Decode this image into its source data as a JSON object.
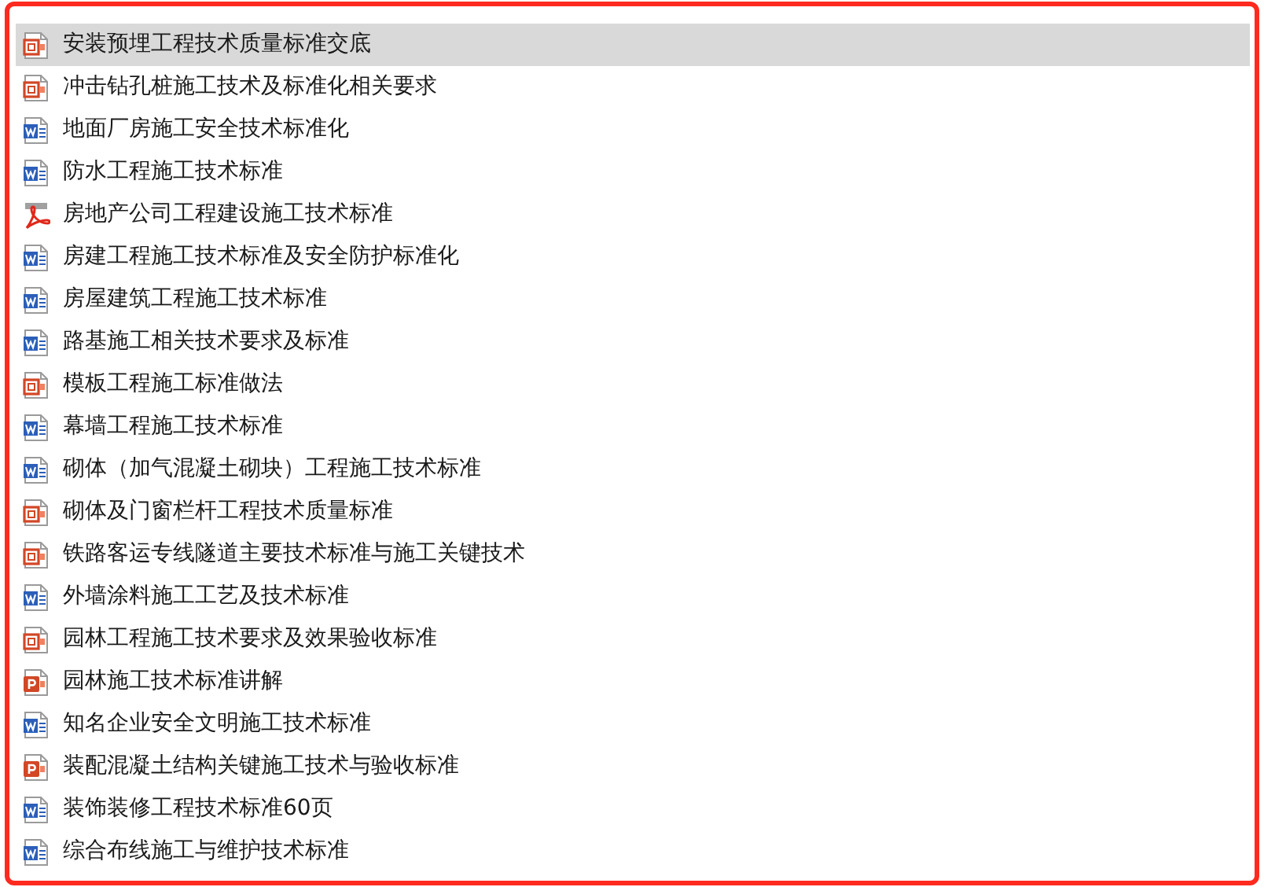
{
  "files": [
    {
      "name": "安装预埋工程技术质量标准交底",
      "kind": "slides-outline",
      "selected": true
    },
    {
      "name": "冲击钻孔桩施工技术及标准化相关要求",
      "kind": "slides-outline",
      "selected": false
    },
    {
      "name": "地面厂房施工安全技术标准化",
      "kind": "word",
      "selected": false
    },
    {
      "name": "防水工程施工技术标准",
      "kind": "word",
      "selected": false
    },
    {
      "name": "房地产公司工程建设施工技术标准",
      "kind": "pdf",
      "selected": false
    },
    {
      "name": "房建工程施工技术标准及安全防护标准化",
      "kind": "word",
      "selected": false
    },
    {
      "name": "房屋建筑工程施工技术标准",
      "kind": "word",
      "selected": false
    },
    {
      "name": "路基施工相关技术要求及标准",
      "kind": "word",
      "selected": false
    },
    {
      "name": "模板工程施工标准做法",
      "kind": "slides-outline",
      "selected": false
    },
    {
      "name": "幕墙工程施工技术标准",
      "kind": "word",
      "selected": false
    },
    {
      "name": "砌体（加气混凝土砌块）工程施工技术标准",
      "kind": "word",
      "selected": false
    },
    {
      "name": "砌体及门窗栏杆工程技术质量标准",
      "kind": "slides-outline",
      "selected": false
    },
    {
      "name": "铁路客运专线隧道主要技术标准与施工关键技术",
      "kind": "slides-outline",
      "selected": false
    },
    {
      "name": "外墙涂料施工工艺及技术标准",
      "kind": "word",
      "selected": false
    },
    {
      "name": "园林工程施工技术要求及效果验收标准",
      "kind": "slides-outline",
      "selected": false
    },
    {
      "name": "园林施工技术标准讲解",
      "kind": "slides",
      "selected": false
    },
    {
      "name": "知名企业安全文明施工技术标准",
      "kind": "word",
      "selected": false
    },
    {
      "name": "装配混凝土结构关键施工技术与验收标准",
      "kind": "slides",
      "selected": false
    },
    {
      "name": "装饰装修工程技术标准60页",
      "kind": "word",
      "selected": false
    },
    {
      "name": "综合布线施工与维护技术标准",
      "kind": "word",
      "selected": false
    }
  ]
}
